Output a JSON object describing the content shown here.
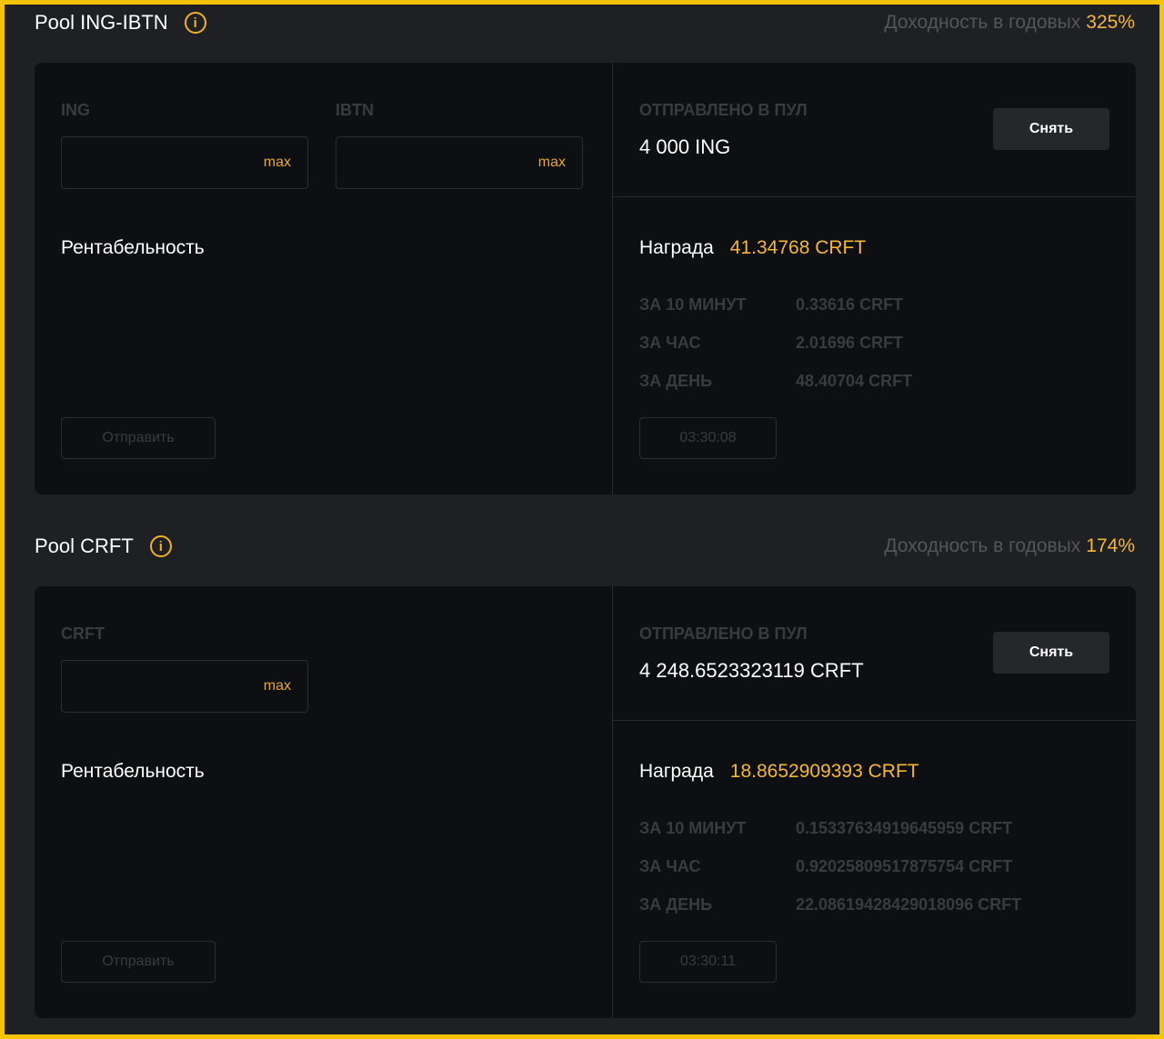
{
  "pools": [
    {
      "title": "Pool ING-IBTN",
      "apy_label": "Доходность в годовых",
      "apy_value": "325%",
      "inputs": [
        {
          "label": "ING",
          "max": "max"
        },
        {
          "label": "IBTN",
          "max": "max"
        }
      ],
      "profitability": "Рентабельность",
      "send": "Отправить",
      "sent_label": "ОТПРАВЛЕНО В ПУЛ",
      "sent_value": "4 000 ING",
      "withdraw": "Снять",
      "reward_label": "Награда",
      "reward_value": "41.34768 CRFT",
      "rates": [
        {
          "k": "ЗА 10 МИНУТ",
          "v": "0.33616 CRFT"
        },
        {
          "k": "ЗА ЧАС",
          "v": "2.01696 CRFT"
        },
        {
          "k": "ЗА ДЕНЬ",
          "v": "48.40704 CRFT"
        }
      ],
      "timer": "03:30:08"
    },
    {
      "title": "Pool CRFT",
      "apy_label": "Доходность в годовых",
      "apy_value": "174%",
      "inputs": [
        {
          "label": "CRFT",
          "max": "max"
        }
      ],
      "profitability": "Рентабельность",
      "send": "Отправить",
      "sent_label": "ОТПРАВЛЕНО В ПУЛ",
      "sent_value": "4 248.6523323119 CRFT",
      "withdraw": "Снять",
      "reward_label": "Награда",
      "reward_value": "18.8652909393 CRFT",
      "rates": [
        {
          "k": "ЗА 10 МИНУТ",
          "v": "0.15337634919645959 CRFT"
        },
        {
          "k": "ЗА ЧАС",
          "v": "0.92025809517875754 CRFT"
        },
        {
          "k": "ЗА ДЕНЬ",
          "v": "22.08619428429018096 CRFT"
        }
      ],
      "timer": "03:30:11"
    }
  ]
}
